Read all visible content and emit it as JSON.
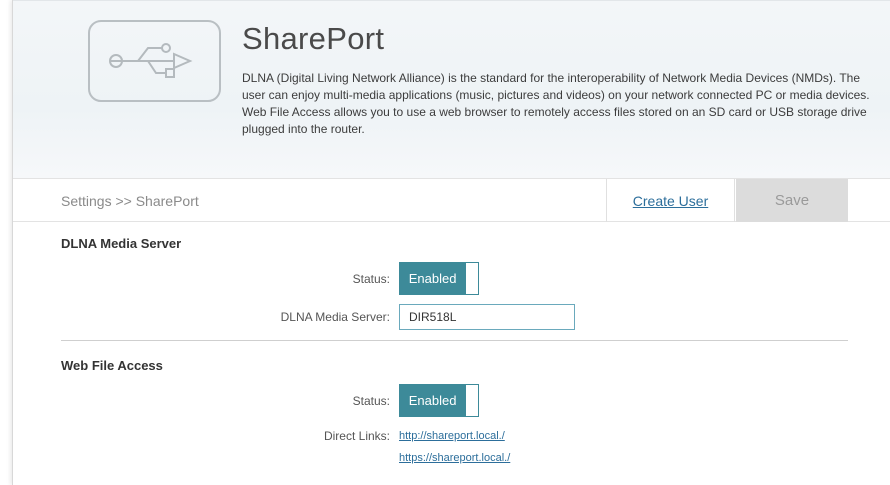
{
  "header": {
    "title": "SharePort",
    "description": "DLNA (Digital Living Network Alliance) is the standard for the interoperability of Network Media Devices (NMDs). The user can enjoy multi-media applications (music, pictures and videos) on your network connected PC or media devices. Web File Access allows you to use a web browser to remotely access files stored on an SD card or USB storage drive plugged into the router.",
    "icon": "usb-icon"
  },
  "toolbar": {
    "breadcrumb": "Settings >> SharePort",
    "create_user_label": "Create User",
    "save_label": "Save"
  },
  "dlna": {
    "section_title": "DLNA Media Server",
    "status_label": "Status:",
    "status_value": "Enabled",
    "server_label": "DLNA Media Server:",
    "server_value": "DIR518L"
  },
  "webfile": {
    "section_title": "Web File Access",
    "status_label": "Status:",
    "status_value": "Enabled",
    "links_label": "Direct Links:",
    "links": [
      "http://shareport.local./",
      "https://shareport.local./"
    ]
  },
  "colors": {
    "accent": "#3d8a99",
    "link": "#2c6e9b",
    "save_bg": "#dcdcdc"
  }
}
